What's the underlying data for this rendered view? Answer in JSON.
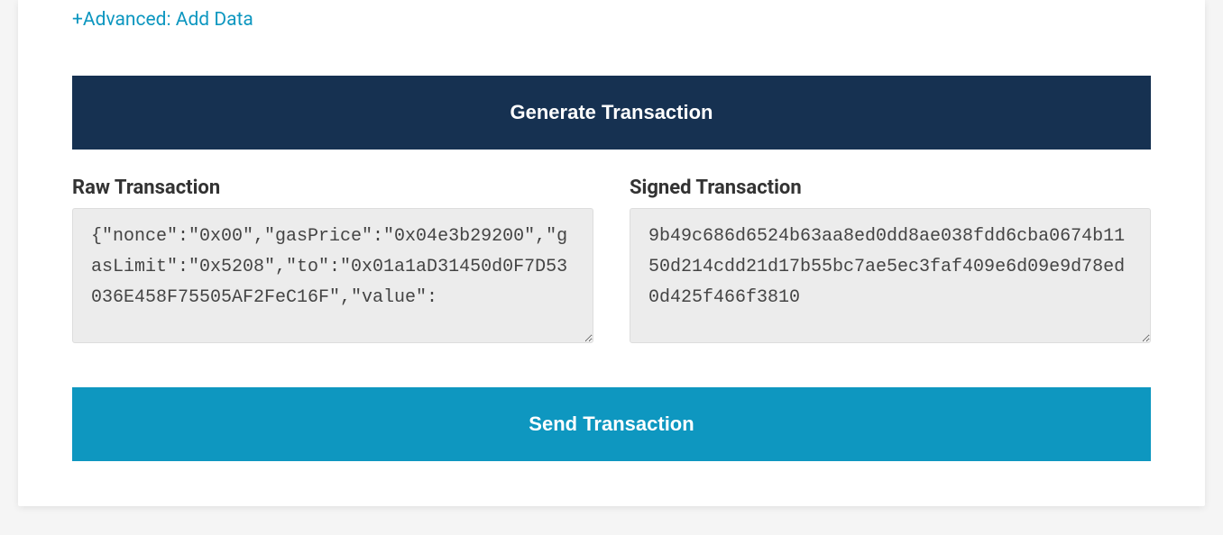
{
  "advanced_link": "+Advanced: Add Data",
  "generate_button": "Generate Transaction",
  "send_button": "Send Transaction",
  "raw": {
    "label": "Raw Transaction",
    "value": "{\"nonce\":\"0x00\",\"gasPrice\":\"0x04e3b29200\",\"gasLimit\":\"0x5208\",\"to\":\"0x01a1aD31450d0F7D53036E458F75505AF2FeC16F\",\"value\":"
  },
  "signed": {
    "label": "Signed Transaction",
    "value": "9b49c686d6524b63aa8ed0dd8ae038fdd6cba0674b1150d214cdd21d17b55bc7ae5ec3faf409e6d09e9d78ed0d425f466f3810"
  }
}
